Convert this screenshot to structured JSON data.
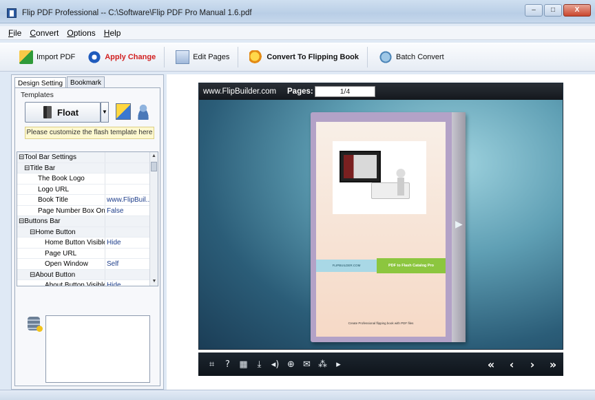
{
  "window": {
    "title": "Flip PDF Professional  -- C:\\Software\\Flip PDF Pro Manual 1.6.pdf",
    "min_glyph": "–",
    "max_glyph": "□",
    "close_glyph": "X"
  },
  "menu": [
    {
      "label": "File",
      "key": "F",
      "rest": "ile"
    },
    {
      "label": "Convert",
      "key": "C",
      "rest": "onvert"
    },
    {
      "label": "Options",
      "key": "O",
      "rest": "ptions"
    },
    {
      "label": "Help",
      "key": "H",
      "rest": "elp"
    }
  ],
  "toolbar": {
    "import_pdf": "Import PDF",
    "apply_change": "Apply Change",
    "edit_pages": "Edit Pages",
    "convert": "Convert To Flipping Book",
    "batch_convert": "Batch Convert"
  },
  "left_panel": {
    "tabs": [
      "Design Setting",
      "Bookmark"
    ],
    "templates_label": "Templates",
    "template_selected": "Float",
    "hint": "Please customize the flash template here",
    "properties": [
      {
        "name": "⊟Tool Bar Settings",
        "value": "",
        "level": 0,
        "group": true
      },
      {
        "name": "⊟Title Bar",
        "value": "",
        "level": 1,
        "group": true
      },
      {
        "name": "The Book Logo",
        "value": "",
        "level": 3,
        "group": false
      },
      {
        "name": "Logo URL",
        "value": "",
        "level": 3,
        "group": false
      },
      {
        "name": "Book Title",
        "value": "www.FlipBuil...",
        "level": 3,
        "group": false
      },
      {
        "name": "Page Number Box On ...",
        "value": "False",
        "level": 3,
        "group": false
      },
      {
        "name": "⊟Buttons Bar",
        "value": "",
        "level": 0,
        "group": true
      },
      {
        "name": "⊟Home Button",
        "value": "",
        "level": 2,
        "group": true
      },
      {
        "name": "Home Button Visible",
        "value": "Hide",
        "level": 4,
        "group": false
      },
      {
        "name": "Page URL",
        "value": "",
        "level": 4,
        "group": false
      },
      {
        "name": "Open Window",
        "value": "Self",
        "level": 4,
        "group": false
      },
      {
        "name": "⊟About Button",
        "value": "",
        "level": 2,
        "group": true
      },
      {
        "name": "About Button Visible",
        "value": "Hide",
        "level": 4,
        "group": false
      }
    ]
  },
  "preview": {
    "site": "www.FlipBuilder.com",
    "pages_label": "Pages:",
    "pages_value": "1/4",
    "banner_left": "FLIPBUILDER.COM",
    "banner_right": "PDF to Flash Catalog Pro",
    "caption": "Create Professional flipping book with PDF files",
    "controls": [
      "⌗",
      "?",
      "▦",
      "⤓",
      "◂)",
      "⊕",
      "✉",
      "⁂",
      "▸"
    ],
    "nav": [
      "«",
      "‹",
      "›",
      "»"
    ]
  }
}
